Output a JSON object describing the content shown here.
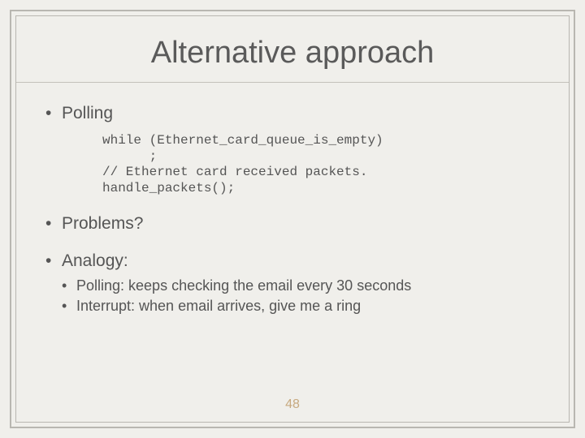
{
  "title": "Alternative approach",
  "bullets": {
    "polling": "Polling",
    "problems": "Problems?",
    "analogy": "Analogy:"
  },
  "code": "while (Ethernet_card_queue_is_empty)\n      ;\n// Ethernet card received packets.\nhandle_packets();",
  "sub": {
    "poll_desc": "Polling: keeps checking the email every 30 seconds",
    "int_desc": "Interrupt: when email arrives, give me a ring"
  },
  "page_number": "48"
}
